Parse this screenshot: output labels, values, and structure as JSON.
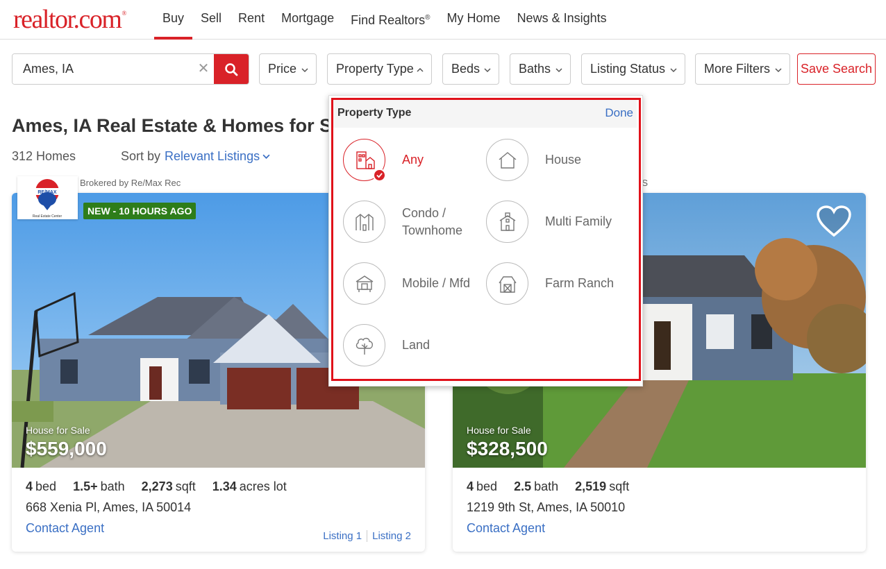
{
  "nav": {
    "logo_text": "realtor.com",
    "logo_mark": "®",
    "links": [
      "Buy",
      "Sell",
      "Rent",
      "Mortgage",
      "Find Realtors",
      "My Home",
      "News & Insights"
    ],
    "find_realtors_mark": "®",
    "active": "Buy"
  },
  "search": {
    "value": "Ames, IA",
    "clear_icon": "close-icon",
    "button_icon": "search-icon"
  },
  "filters": {
    "price": "Price",
    "property_type": "Property Type",
    "beds": "Beds",
    "baths": "Baths",
    "listing_status": "Listing Status",
    "more_filters": "More Filters",
    "save_search": "Save Search"
  },
  "results": {
    "title": "Ames, IA Real Estate & Homes for Sa",
    "count": "312 Homes",
    "sort_label": "Sort by",
    "sort_value": "Relevant Listings"
  },
  "cards": [
    {
      "broker": "Brokered by Re/Max Rec",
      "badge": "NEW - 10 HOURS AGO",
      "type": "House for Sale",
      "price": "$559,000",
      "beds": "4",
      "beds_unit": "bed",
      "baths": "1.5+",
      "baths_unit": "bath",
      "sqft": "2,273",
      "sqft_unit": "sqft",
      "lot": "1.34",
      "lot_unit": "acres lot",
      "address": "668 Xenia Pl, Ames, IA 50014",
      "contact": "Contact Agent",
      "listing1": "Listing 1",
      "listing2": "Listing 2"
    },
    {
      "broker": "RS",
      "type": "House for Sale",
      "price": "$328,500",
      "beds": "4",
      "beds_unit": "bed",
      "baths": "2.5",
      "baths_unit": "bath",
      "sqft": "2,519",
      "sqft_unit": "sqft",
      "address": "1219 9th St, Ames, IA 50010",
      "contact": "Contact Agent"
    }
  ],
  "dropdown": {
    "title": "Property Type",
    "done": "Done",
    "options": [
      {
        "label": "Any",
        "icon": "building-icon",
        "selected": true
      },
      {
        "label": "House",
        "icon": "house-icon",
        "selected": false
      },
      {
        "label": "Condo / Townhome",
        "icon": "townhome-icon",
        "selected": false
      },
      {
        "label": "Multi Family",
        "icon": "multi-family-icon",
        "selected": false
      },
      {
        "label": "Mobile / Mfd",
        "icon": "mobile-home-icon",
        "selected": false
      },
      {
        "label": "Farm Ranch",
        "icon": "barn-icon",
        "selected": false
      },
      {
        "label": "Land",
        "icon": "tree-icon",
        "selected": false
      }
    ]
  },
  "colors": {
    "brand_red": "#d92228",
    "link_blue": "#3a6fc4",
    "highlight_frame": "#e0111a",
    "new_badge_green": "#2e7d1a"
  }
}
